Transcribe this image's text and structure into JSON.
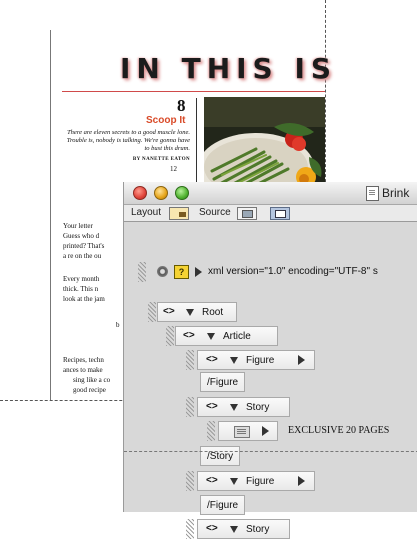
{
  "page": {
    "headline": "IN THIS IS",
    "page_number": "8",
    "section_title": "Scoop It",
    "deck": "There are eleven secrets to a good muscle lone. Trouble is, nobody is talking. We're gonna have to bust this drum.",
    "byline": "BY NANETTE EATON",
    "page_ref": "12",
    "body_paragraphs": [
      "Your letter",
      "Guess who d",
      "printed? That's",
      "a re on the ou",
      "Every month",
      "thick. This n",
      "look at the jam",
      "b",
      "Recipes, techn",
      "ances to make",
      "sing like a co",
      "good recipe"
    ]
  },
  "window": {
    "title": "Brink",
    "toolbar": {
      "layout_label": "Layout",
      "source_label": "Source"
    },
    "tree": {
      "prolog": "xml version=\"1.0\" encoding=\"UTF-8\" s",
      "nodes": [
        {
          "type": "open",
          "label": "Root"
        },
        {
          "type": "open",
          "label": "Article"
        },
        {
          "type": "open",
          "label": "Figure"
        },
        {
          "type": "close",
          "label": "/Figure"
        },
        {
          "type": "open",
          "label": "Story"
        },
        {
          "type": "text",
          "label": "EXCLUSIVE 20 PAGES"
        },
        {
          "type": "close",
          "label": "/Story"
        },
        {
          "type": "open",
          "label": "Figure"
        },
        {
          "type": "close",
          "label": "/Figure"
        },
        {
          "type": "open",
          "label": "Story"
        }
      ]
    }
  }
}
